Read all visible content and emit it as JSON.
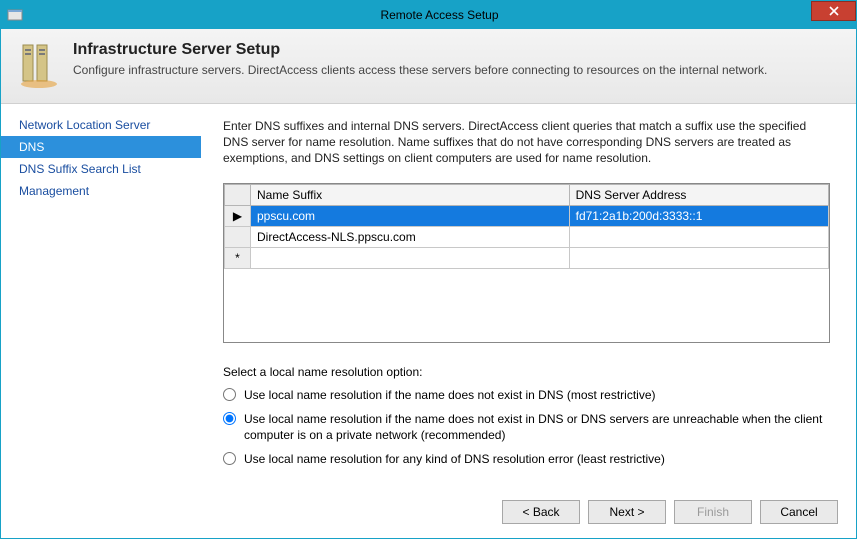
{
  "window": {
    "title": "Remote Access Setup"
  },
  "header": {
    "title": "Infrastructure Server Setup",
    "subtitle": "Configure infrastructure servers. DirectAccess clients access these servers before connecting to resources on the internal network."
  },
  "sidebar": {
    "items": [
      {
        "label": "Network Location Server",
        "selected": false
      },
      {
        "label": "DNS",
        "selected": true
      },
      {
        "label": "DNS Suffix Search List",
        "selected": false
      },
      {
        "label": "Management",
        "selected": false
      }
    ]
  },
  "content": {
    "intro": "Enter DNS suffixes and internal DNS servers.  DirectAccess client queries that match a suffix use the specified DNS server for name resolution. Name suffixes that do not have corresponding DNS servers are treated as exemptions, and DNS settings on client computers are used for name resolution.",
    "grid": {
      "col1": "Name Suffix",
      "col2": "DNS Server Address",
      "rows": [
        {
          "marker": "▶",
          "suffix": "ppscu.com",
          "address": "fd71:2a1b:200d:3333::1",
          "selected": true
        },
        {
          "marker": "",
          "suffix": "DirectAccess-NLS.ppscu.com",
          "address": "",
          "selected": false
        },
        {
          "marker": "*",
          "suffix": "",
          "address": "",
          "selected": false
        }
      ]
    },
    "radio": {
      "label": "Select a local name resolution option:",
      "options": [
        {
          "text": "Use local name resolution if the name does not exist in DNS (most restrictive)",
          "checked": false
        },
        {
          "text": "Use local name resolution if the name does not exist in DNS or DNS servers are unreachable when the client computer is on a private network (recommended)",
          "checked": true
        },
        {
          "text": "Use local name resolution for any kind of DNS resolution error (least restrictive)",
          "checked": false
        }
      ]
    }
  },
  "footer": {
    "back": "< Back",
    "next": "Next >",
    "finish": "Finish",
    "cancel": "Cancel"
  }
}
